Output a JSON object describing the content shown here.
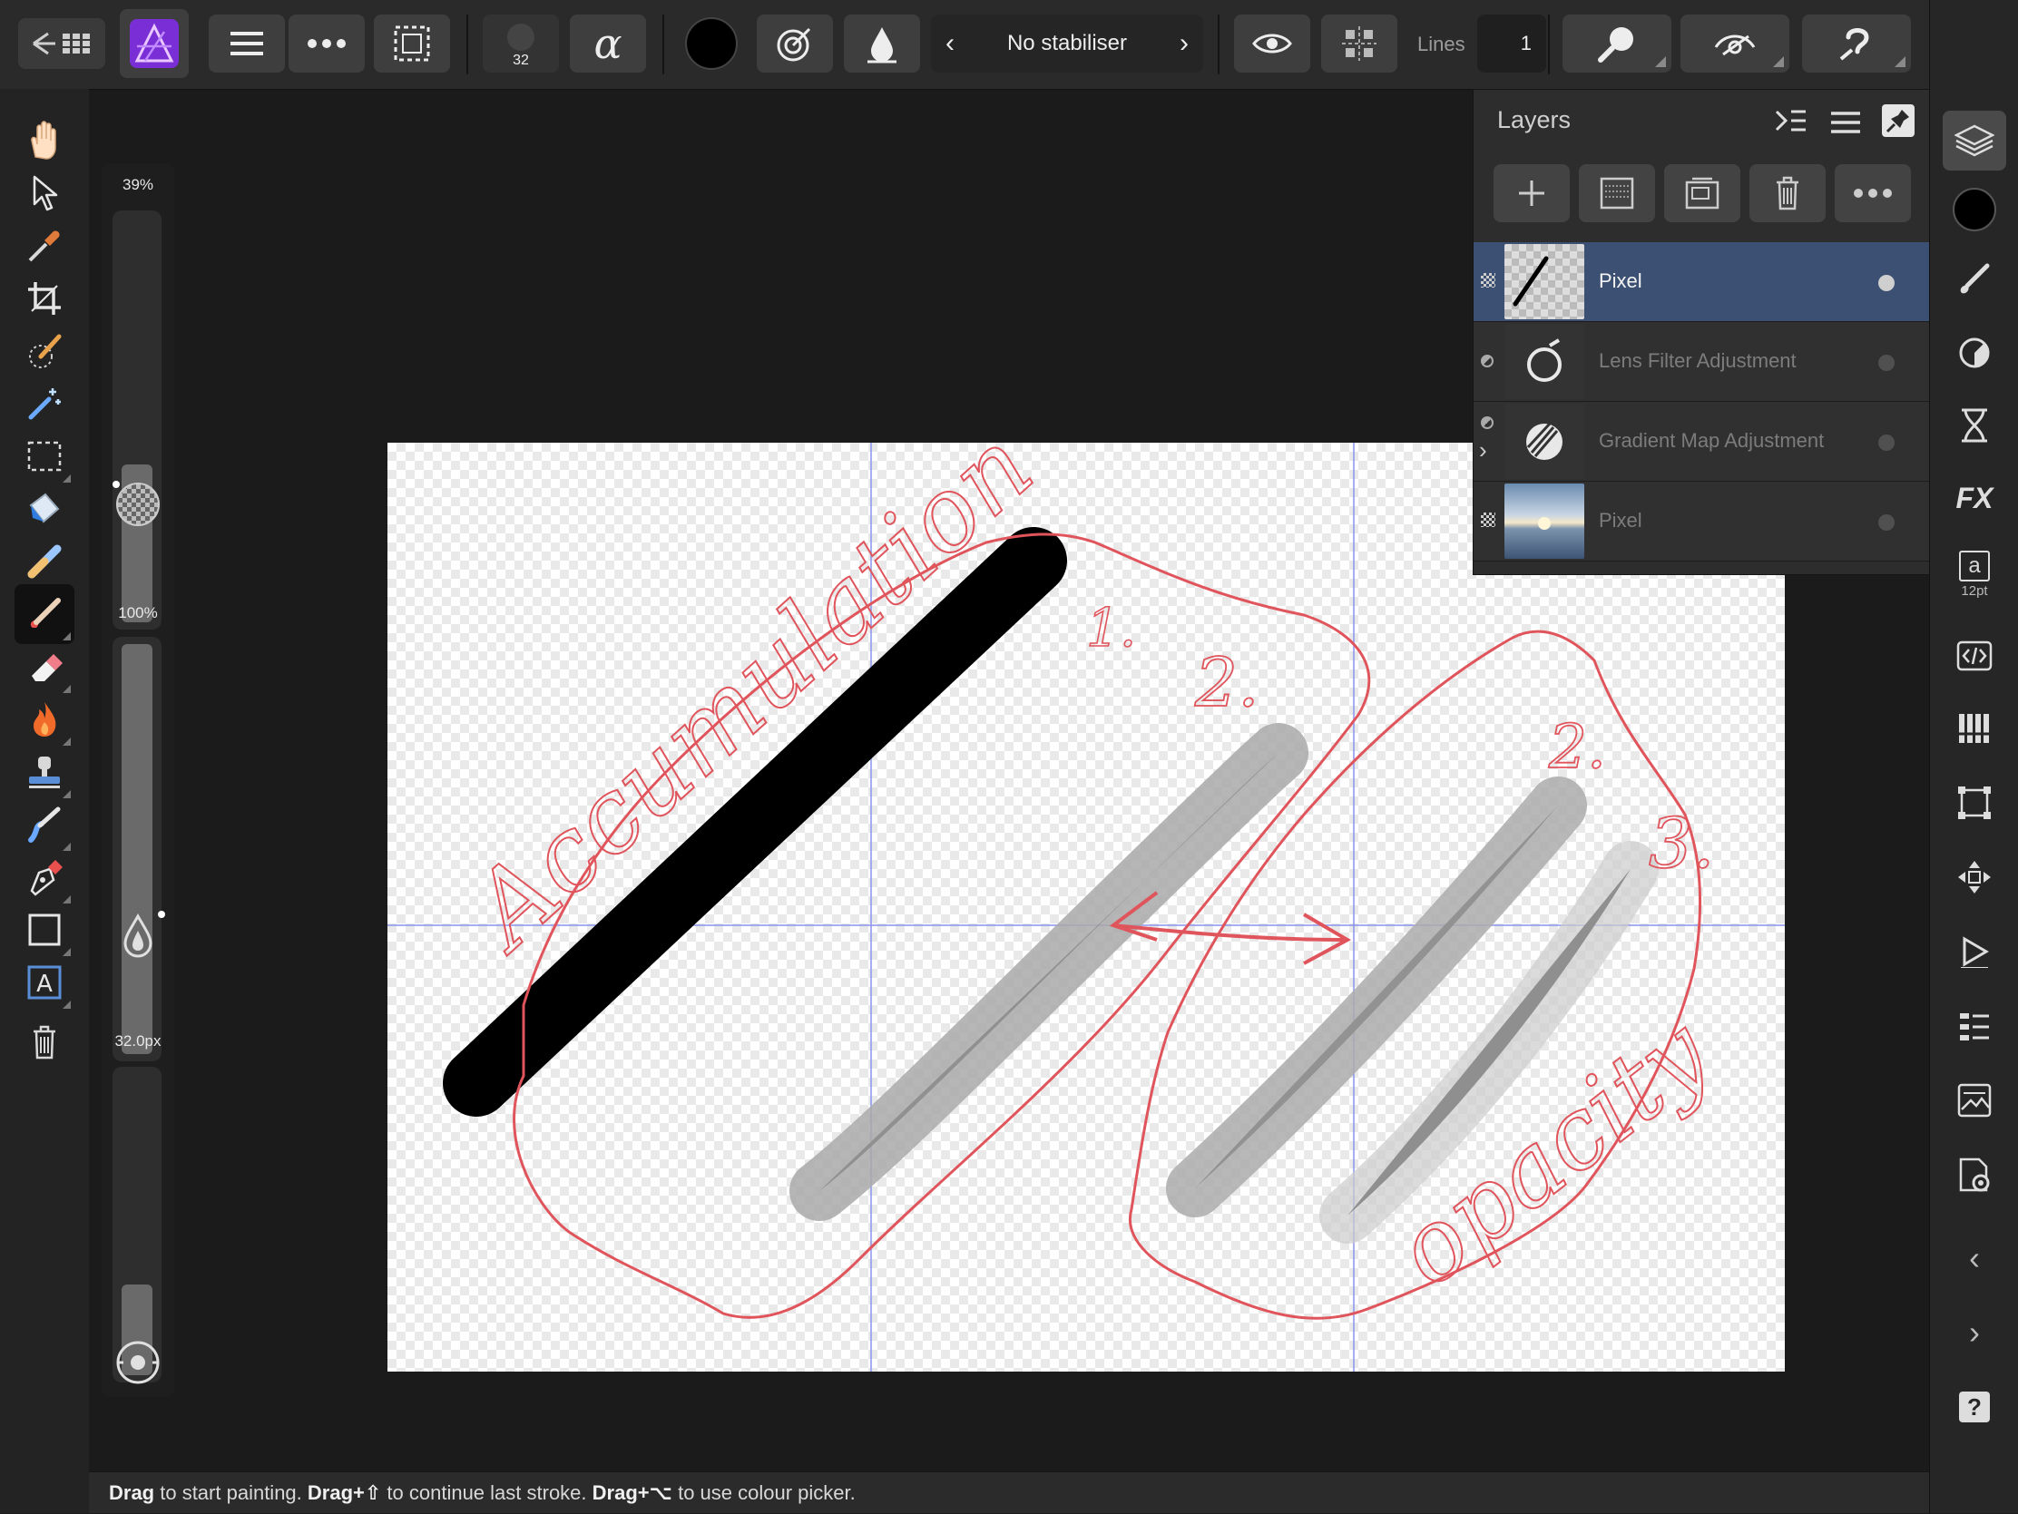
{
  "toolbar": {
    "brush_size_label": "32",
    "stabiliser_label": "No stabiliser",
    "lines_label": "Lines",
    "lines_value": "1"
  },
  "sliders": {
    "opacity_label": "39%",
    "opacity_fraction": 0.39,
    "flow_label": "100%",
    "flow_fraction": 1.0,
    "width_label": "32.0px",
    "width_fraction": 0.3
  },
  "layers": {
    "title": "Layers",
    "items": [
      {
        "name": "Pixel",
        "selected": true
      },
      {
        "name": "Lens Filter Adjustment",
        "selected": false
      },
      {
        "name": "Gradient Map Adjustment",
        "selected": false
      },
      {
        "name": "Pixel",
        "selected": false
      }
    ]
  },
  "right_bar": {
    "font_size_label": "12pt",
    "character_glyph": "a"
  },
  "canvas": {
    "annotation_accumulation": "Accumulation",
    "annotation_opacity": "opacity",
    "label_1": "1.",
    "label_2a": "2.",
    "label_2b": "2.",
    "label_3": "3."
  },
  "status": {
    "drag1": "Drag",
    "text1": " to start painting. ",
    "drag2": "Drag+⇧",
    "text2": " to continue last stroke. ",
    "drag3": "Drag+⌥",
    "text3": " to use colour picker."
  },
  "colors": {
    "accent_layer_selected": "#3b5072",
    "annotation_red": "#e0545c",
    "guide_blue": "#7d86e6",
    "affinity_purple": "#8a3fe0"
  }
}
